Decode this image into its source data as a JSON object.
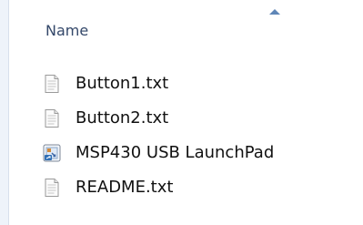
{
  "header": {
    "sort_direction": "ascending",
    "name_column_label": "Name"
  },
  "files": [
    {
      "name": "Button1.txt",
      "icon": "text-document-icon"
    },
    {
      "name": "Button2.txt",
      "icon": "text-document-icon"
    },
    {
      "name": "MSP430 USB LaunchPad",
      "icon": "shortcut-icon"
    },
    {
      "name": "README.txt",
      "icon": "text-document-icon"
    }
  ],
  "colors": {
    "column_label": "#34486a",
    "sort_arrow": "#5f86b7",
    "file_text": "#111111",
    "accent": "#2f6fb6"
  }
}
